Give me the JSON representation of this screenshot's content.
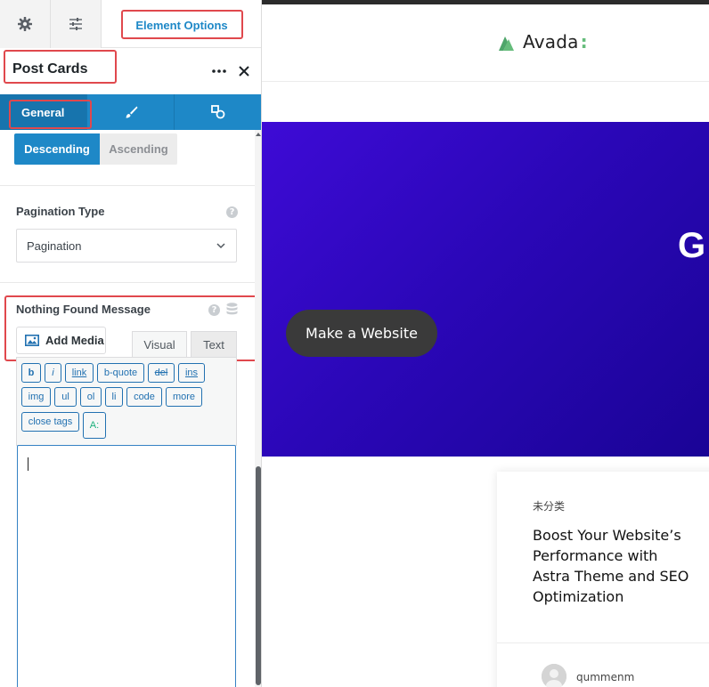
{
  "builder": {
    "top_tabs": {
      "settings_icon": "gear-icon",
      "options_icon": "sliders-icon",
      "element_options_label": "Element Options"
    },
    "panel": {
      "title": "Post Cards",
      "more_icon": "ellipsis-icon",
      "close_icon": "close-icon"
    },
    "subtabs": {
      "general_label": "General",
      "design_icon": "brush-icon",
      "extras_icon": "shapes-icon"
    },
    "order": {
      "options": [
        "Descending",
        "Ascending"
      ],
      "selected": "Descending"
    },
    "pagination": {
      "label": "Pagination Type",
      "value": "Pagination"
    },
    "nothing_found": {
      "label": "Nothing Found Message",
      "add_media_label": "Add Media",
      "mode_visual": "Visual",
      "mode_text": "Text",
      "active_mode": "Text",
      "quicktags": [
        "b",
        "i",
        "link",
        "b-quote",
        "del",
        "ins",
        "img",
        "ul",
        "ol",
        "li",
        "code",
        "more",
        "close tags",
        "A:"
      ],
      "content": ""
    }
  },
  "preview": {
    "logo_text": "Avada",
    "logo_colon": ":",
    "hero_letter": "G",
    "hero_button": "Make a Website",
    "card": {
      "category": "未分类",
      "title": "Boost Your Website’s Performance with Astra Theme and SEO Optimization",
      "author": "qummenm"
    }
  },
  "colors": {
    "accent": "#1e88c7",
    "highlight_box": "#e0484d",
    "hero_gradient_start": "#3e0bd6",
    "hero_gradient_end": "#1a0496",
    "logo_green": "#65bc7b"
  }
}
